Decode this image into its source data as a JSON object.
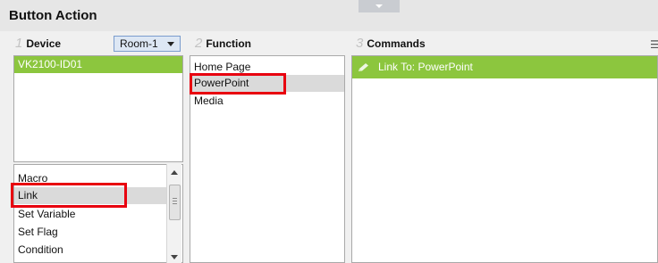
{
  "window": {
    "title": "Button Action"
  },
  "device_column": {
    "number": "1",
    "label": "Device",
    "room_select": {
      "value": "Room-1"
    },
    "devices": [
      {
        "label": "VK2100-ID01",
        "selected": true
      }
    ],
    "action_types": [
      {
        "label": "Macro",
        "selected": false
      },
      {
        "label": "Link",
        "selected": true
      },
      {
        "label": "Set Variable",
        "selected": false
      },
      {
        "label": "Set Flag",
        "selected": false
      },
      {
        "label": "Condition",
        "selected": false
      }
    ]
  },
  "function_column": {
    "number": "2",
    "label": "Function",
    "items": [
      {
        "label": "Home Page",
        "selected": false
      },
      {
        "label": "PowerPoint",
        "selected": true
      },
      {
        "label": "Media",
        "selected": false
      }
    ]
  },
  "commands_column": {
    "number": "3",
    "label": "Commands",
    "items": [
      {
        "label": "Link To: PowerPoint",
        "icon": "pencil-icon"
      }
    ]
  },
  "colors": {
    "selected_green": "#8cc63e",
    "selected_grey": "#dadada",
    "highlight_red": "#e8000f",
    "dropdown_bg": "#dde7f4"
  }
}
